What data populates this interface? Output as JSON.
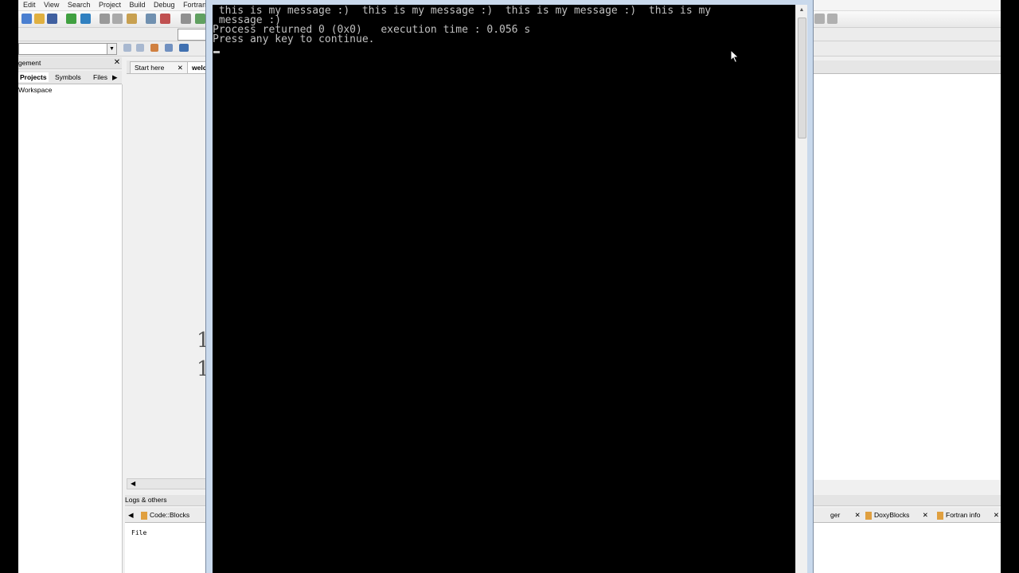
{
  "ide": {
    "menu": [
      "Edit",
      "View",
      "Search",
      "Project",
      "Build",
      "Debug",
      "Fortran"
    ],
    "management": {
      "title": "gement",
      "close": "✕",
      "tabs": [
        "Projects",
        "Symbols",
        "Files"
      ],
      "tabs_arrow": "▶",
      "tree_root": "Workspace"
    },
    "editor": {
      "tabs": [
        {
          "label": "Start here",
          "close": "✕"
        },
        {
          "label": "welc"
        }
      ],
      "line_numbers": [
        "1",
        "1"
      ],
      "hscroll_arrow": "◀"
    },
    "logs": {
      "title": "Logs & others",
      "tab_arrow": "◀",
      "tabs": [
        {
          "label": "Code::Blocks"
        },
        {
          "label": "ger",
          "close": "✕"
        },
        {
          "label": "DoxyBlocks",
          "close": "✕"
        },
        {
          "label": "Fortran info",
          "close": "✕"
        }
      ],
      "column_header": "File"
    },
    "combo_arrow": "▼"
  },
  "console": {
    "lines": [
      " this is my message :)  this is my message :)  this is my message :)  this is my",
      " message :)",
      "Process returned 0 (0x0)   execution time : 0.056 s",
      "Press any key to continue."
    ],
    "scroll_up": "▲"
  },
  "colors": {
    "console_bg": "#000000",
    "console_text": "#c0c0c0",
    "window_frame": "#c9d9ec"
  }
}
